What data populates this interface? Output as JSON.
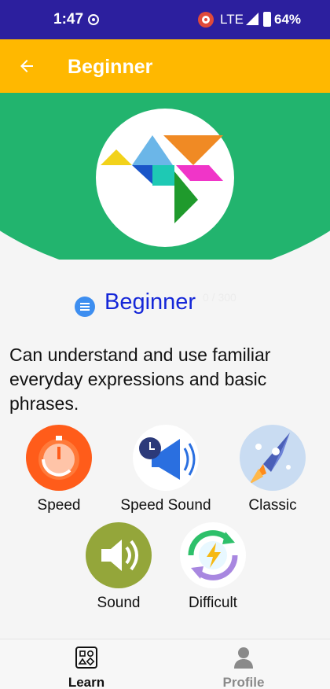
{
  "status_bar": {
    "time": "1:47",
    "network": "LTE",
    "battery": "64%"
  },
  "app_bar": {
    "title": "Beginner",
    "back_icon": "arrow-left-icon"
  },
  "level": {
    "name": "Beginner",
    "progress": "0 / 300",
    "description": "Can understand and use familiar everyday expressions and basic phrases."
  },
  "modes": [
    {
      "label": "Speed",
      "icon": "stopwatch-icon"
    },
    {
      "label": "Speed Sound",
      "icon": "megaphone-clock-icon"
    },
    {
      "label": "Classic",
      "icon": "rocket-icon"
    },
    {
      "label": "Sound",
      "icon": "speaker-icon"
    },
    {
      "label": "Difficult",
      "icon": "lightning-cycle-icon"
    }
  ],
  "bottom_nav": {
    "learn": "Learn",
    "profile": "Profile"
  },
  "colors": {
    "status_bar": "#2c1f9e",
    "app_bar": "#ffb800",
    "hero_green": "#22b46e",
    "level_blue": "#1527d8"
  }
}
